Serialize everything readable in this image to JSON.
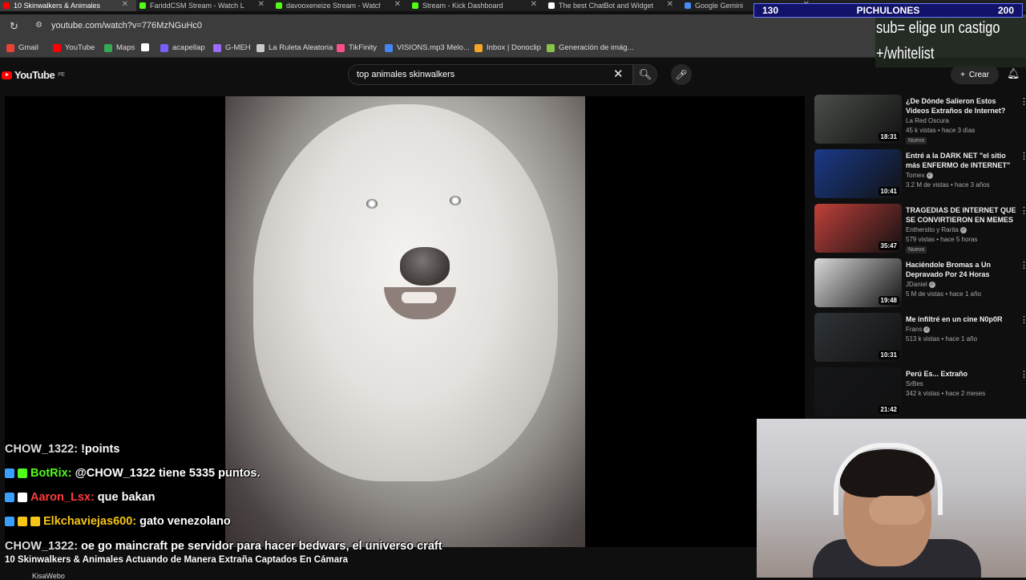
{
  "browser": {
    "tabs": [
      {
        "title": "10 Skinwalkers & Animales",
        "color": "#ff0000",
        "active": true
      },
      {
        "title": "FariddCSM Stream - Watch Live",
        "color": "#53fc18",
        "active": false
      },
      {
        "title": "davooxeneize Stream - Watch L",
        "color": "#53fc18",
        "active": false
      },
      {
        "title": "Stream - Kick Dashboard",
        "color": "#53fc18",
        "active": false
      },
      {
        "title": "The best ChatBot and Widgets",
        "color": "#ffffff",
        "active": false
      },
      {
        "title": "Google Gemini",
        "color": "#4a8af4",
        "active": false
      }
    ],
    "url": "youtube.com/watch?v=776MzNGuHc0",
    "bookmarks": [
      {
        "label": "Gmail",
        "color": "#ea4335"
      },
      {
        "label": "YouTube",
        "color": "#ff0000"
      },
      {
        "label": "Maps",
        "color": "#34a853"
      },
      {
        "label": "",
        "color": "#ffffff"
      },
      {
        "label": "acapellap",
        "color": "#7b5cff"
      },
      {
        "label": "G-MEH",
        "color": "#9c6bff"
      },
      {
        "label": "La Ruleta Aleatoria",
        "color": "#c9c9c9"
      },
      {
        "label": "TikFinity",
        "color": "#ff4d8d"
      },
      {
        "label": "VISIONS.mp3 Melo...",
        "color": "#4285f4"
      },
      {
        "label": "Inbox | Donoclip",
        "color": "#f5a623"
      },
      {
        "label": "Generación de imág...",
        "color": "#8bc34a"
      }
    ]
  },
  "youtube": {
    "logo_text": "YouTube",
    "region": "PE",
    "search_value": "top animales skinwalkers",
    "create_label": "Crear",
    "video_caption": "10 Skinwalkers & Animales Actuando de Manera Extraña Captados En Cámara",
    "channel_below": "KisaWebo",
    "recommendations": [
      {
        "title": "¿De Dónde Salieron Estos Videos Extraños de Internet?",
        "channel": "La Red Oscura",
        "verified": false,
        "meta": "45 k vistas • hace 3 días",
        "new": "Nuevo",
        "duration": "18:31",
        "thumb": "#4a4f4a"
      },
      {
        "title": "Entré a la DARK NET \"el sitio más ENFERMO de INTERNET\"",
        "channel": "Tomex",
        "verified": true,
        "meta": "3.2 M de vistas • hace 3 años",
        "new": "",
        "duration": "10:41",
        "thumb": "#1a3a8a"
      },
      {
        "title": "TRAGEDIAS DE INTERNET QUE SE CONVIRTIERON EN MEMES",
        "channel": "Enthersito y Rarita",
        "verified": true,
        "meta": "579 vistas • hace 5 horas",
        "new": "Nuevo",
        "duration": "35:47",
        "thumb": "#c0403a"
      },
      {
        "title": "Haciéndole Bromas a Un Depravado Por 24 Horas",
        "channel": "JDaniel",
        "verified": true,
        "meta": "5 M de vistas • hace 1 año",
        "new": "",
        "duration": "19:48",
        "thumb": "#d9d9d9"
      },
      {
        "title": "Me infiltré en un cine N0p0R",
        "channel": "Frans",
        "verified": true,
        "meta": "513 k vistas • hace 1 año",
        "new": "",
        "duration": "10:31",
        "thumb": "#2f3438"
      },
      {
        "title": "Perú Es... Extraño",
        "channel": "SrBes",
        "verified": false,
        "meta": "342 k vistas • hace 2 meses",
        "new": "",
        "duration": "21:42",
        "thumb": "#15161a"
      }
    ]
  },
  "stream_overlay": {
    "counter_left": "130",
    "counter_label": "PICHULONES",
    "counter_right": "200",
    "sub_line1": "sub= elige un castigo",
    "sub_line2": "+/whitelist"
  },
  "chat": [
    {
      "user": "CHOW_1322",
      "user_color": "#dddddd",
      "message": "!points",
      "badges": []
    },
    {
      "user": "BotRix",
      "user_color": "#53fc18",
      "message": "@CHOW_1322 tiene 5335 puntos.",
      "badges": [
        "#3aa0ff",
        "#53fc18"
      ]
    },
    {
      "user": "Aaron_Lsx",
      "user_color": "#ff3b3b",
      "message": "que bakan",
      "badges": [
        "#3aa0ff",
        "#ffffff"
      ]
    },
    {
      "user": "Elkchaviejas600",
      "user_color": "#f5c518",
      "message": "gato venezolano",
      "badges": [
        "#3aa0ff",
        "#f5c518",
        "#f5c518"
      ]
    },
    {
      "user": "CHOW_1322",
      "user_color": "#dddddd",
      "message": "oe go maincraft pe servidor para hacer bedwars, el universo craft",
      "badges": []
    }
  ]
}
